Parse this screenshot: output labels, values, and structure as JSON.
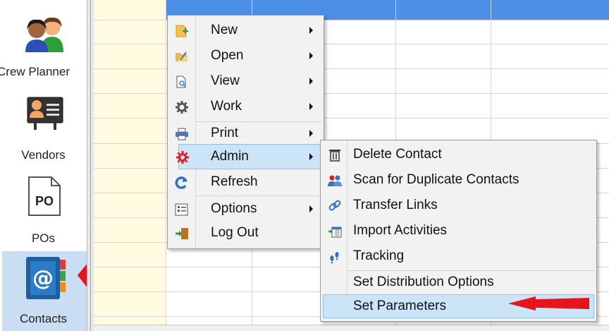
{
  "sidebar": {
    "items": [
      {
        "label": "Crew Planner",
        "icon": "crew-planner-icon"
      },
      {
        "label": "Vendors",
        "icon": "vendors-icon"
      },
      {
        "label": "POs",
        "icon": "po-document-icon",
        "icon_text": "PO"
      },
      {
        "label": "Contacts",
        "icon": "contacts-book-icon",
        "selected": true
      }
    ]
  },
  "main_menu": {
    "items": [
      {
        "label": "New",
        "icon": "new-document-icon",
        "submenu": true
      },
      {
        "label": "Open",
        "icon": "open-folder-icon",
        "submenu": true
      },
      {
        "label": "View",
        "icon": "view-document-icon",
        "submenu": true
      },
      {
        "label": "Work",
        "icon": "gear-icon",
        "submenu": true
      },
      {
        "label": "Print",
        "icon": "printer-icon",
        "submenu": true
      },
      {
        "label": "Admin",
        "icon": "admin-gear-icon",
        "submenu": true,
        "highlighted": true
      },
      {
        "label": "Refresh",
        "icon": "refresh-icon",
        "submenu": false
      },
      {
        "label": "Options",
        "icon": "options-list-icon",
        "submenu": true
      },
      {
        "label": "Log Out",
        "icon": "logout-door-icon",
        "submenu": false
      }
    ]
  },
  "admin_submenu": {
    "items": [
      {
        "label": "Delete Contact",
        "icon": "trash-icon"
      },
      {
        "label": "Scan for Duplicate Contacts",
        "icon": "duplicate-users-icon"
      },
      {
        "label": "Transfer Links",
        "icon": "link-icon"
      },
      {
        "label": "Import Activities",
        "icon": "import-calendar-icon"
      },
      {
        "label": "Tracking",
        "icon": "footprints-icon"
      },
      {
        "label": "Set Distribution Options",
        "icon": ""
      },
      {
        "label": "Set Parameters",
        "icon": "",
        "highlighted": true
      }
    ]
  },
  "colors": {
    "accent_header": "#4d8fe7",
    "highlight": "#cce4f7",
    "annotation_arrow": "#e8141c",
    "grid_first_column": "#fffbe0"
  }
}
